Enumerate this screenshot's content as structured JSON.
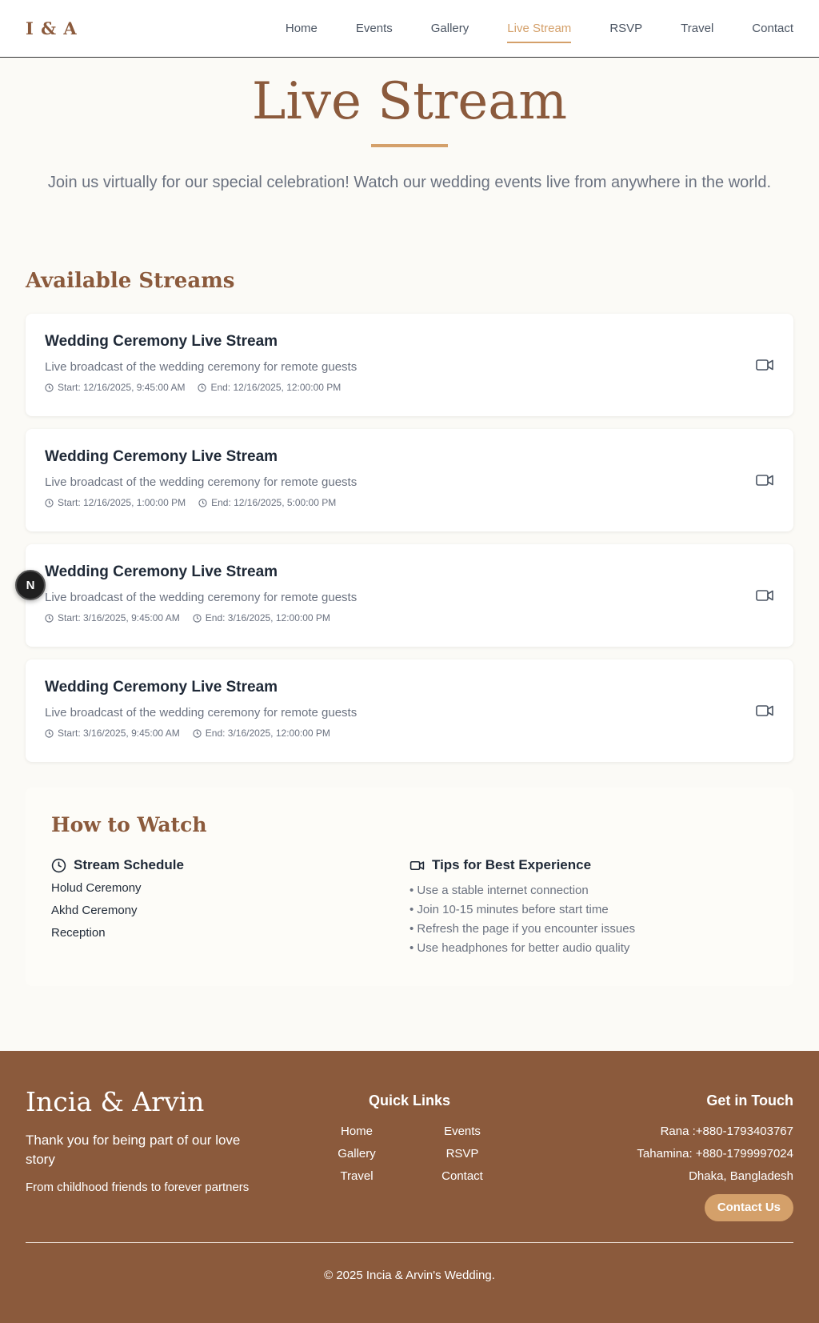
{
  "nav": {
    "logo": "I & A",
    "links": [
      {
        "label": "Home",
        "active": false
      },
      {
        "label": "Events",
        "active": false
      },
      {
        "label": "Gallery",
        "active": false
      },
      {
        "label": "Live Stream",
        "active": true
      },
      {
        "label": "RSVP",
        "active": false
      },
      {
        "label": "Travel",
        "active": false
      },
      {
        "label": "Contact",
        "active": false
      }
    ]
  },
  "hero": {
    "title": "Live Stream",
    "subtitle": "Join us virtually for our special celebration! Watch our wedding events live from anywhere in the world."
  },
  "streams": {
    "heading": "Available Streams",
    "items": [
      {
        "title": "Wedding Ceremony Live Stream",
        "description": "Live broadcast of the wedding ceremony for remote guests",
        "start": "Start: 12/16/2025, 9:45:00 AM",
        "end": "End: 12/16/2025, 12:00:00 PM",
        "icon": "video-camera-icon"
      },
      {
        "title": "Wedding Ceremony Live Stream",
        "description": "Live broadcast of the wedding ceremony for remote guests",
        "start": "Start: 12/16/2025, 1:00:00 PM",
        "end": "End: 12/16/2025, 5:00:00 PM",
        "icon": "video-camera-icon"
      },
      {
        "title": "Wedding Ceremony Live Stream",
        "description": "Live broadcast of the wedding ceremony for remote guests",
        "start": "Start: 3/16/2025, 9:45:00 AM",
        "end": "End: 3/16/2025, 12:00:00 PM",
        "icon": "video-camera-icon"
      },
      {
        "title": "Wedding Ceremony Live Stream",
        "description": "Live broadcast of the wedding ceremony for remote guests",
        "start": "Start: 3/16/2025, 9:45:00 AM",
        "end": "End: 3/16/2025, 12:00:00 PM",
        "icon": "video-camera-icon"
      }
    ]
  },
  "fab": {
    "label": "N"
  },
  "how": {
    "title": "How to Watch",
    "schedule": {
      "heading": "Stream Schedule",
      "icon": "clock-icon",
      "items": [
        "Holud Ceremony",
        "Akhd Ceremony",
        "Reception"
      ]
    },
    "tips": {
      "heading": "Tips for Best Experience",
      "icon": "video-camera-icon",
      "items": [
        "• Use a stable internet connection",
        "• Join 10-15 minutes before start time",
        "• Refresh the page if you encounter issues",
        "• Use headphones for better audio quality"
      ]
    }
  },
  "footer": {
    "brand": "Incia & Arvin",
    "tagline": "Thank you for being part of our love story",
    "subtagline": "From childhood friends to forever partners",
    "quick_links_title": "Quick Links",
    "quick_links": [
      "Home",
      "Events",
      "Gallery",
      "RSVP",
      "Travel",
      "Contact"
    ],
    "contact_title": "Get in Touch",
    "contacts": [
      "Rana :+880-1793403767",
      "Tahamina: +880-1799997024",
      "Dhaka, Bangladesh"
    ],
    "contact_button": "Contact Us",
    "copyright": "© 2025 Incia & Arvin's Wedding."
  },
  "colors": {
    "brand_brown": "#8b5a3c",
    "accent_gold": "#d4a06a",
    "page_bg": "#fbfaf6"
  }
}
